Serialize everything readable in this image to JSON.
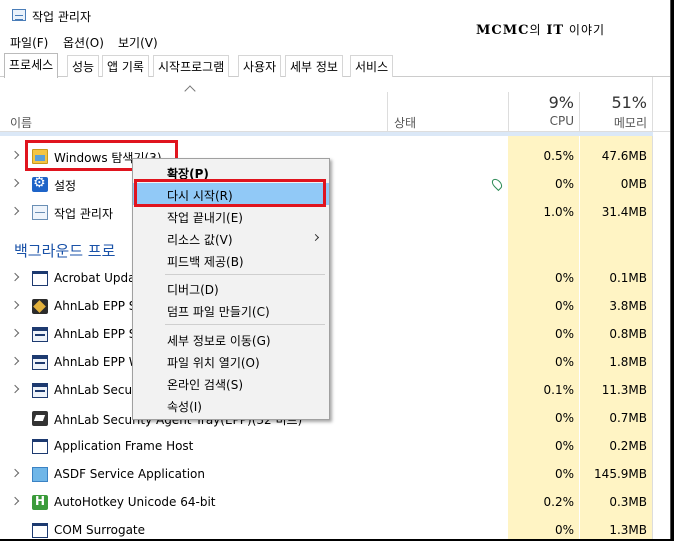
{
  "window": {
    "title": "작업 관리자"
  },
  "watermark": {
    "left": "MCMC",
    "mid": "의 ",
    "brand": "IT",
    "right": " 이야기"
  },
  "menu": {
    "file": "파일(F)",
    "options": "옵션(O)",
    "view": "보기(V)"
  },
  "tabs": [
    "프로세스",
    "성능",
    "앱 기록",
    "시작프로그램",
    "사용자",
    "세부 정보",
    "서비스"
  ],
  "columns": {
    "name": "이름",
    "status": "상태",
    "cpu_pct": "9%",
    "cpu_label": "CPU",
    "mem_pct": "51%",
    "mem_label": "메모리"
  },
  "rows": [
    {
      "name": "Windows 탐색기(3)",
      "cpu": "0.5%",
      "mem": "47.6MB",
      "icon": "folder-icon"
    },
    {
      "name": "설정",
      "cpu": "0%",
      "mem": "0MB",
      "icon": "gear-icon",
      "status_icon": "leaf-icon"
    },
    {
      "name": "작업 관리자",
      "cpu": "1.0%",
      "mem": "31.4MB",
      "icon": "task-manager-icon"
    },
    {
      "name": "Acrobat Updat",
      "cpu": "0%",
      "mem": "0.1MB",
      "icon": "window-icon"
    },
    {
      "name": "AhnLab EPP Se",
      "cpu": "0%",
      "mem": "3.8MB",
      "icon": "ahnlab-icon"
    },
    {
      "name": "AhnLab EPP Se",
      "cpu": "0%",
      "mem": "0.8MB",
      "icon": "ahnlab-window-icon"
    },
    {
      "name": "AhnLab EPP W",
      "cpu": "0%",
      "mem": "1.8MB",
      "icon": "ahnlab-window-icon"
    },
    {
      "name": "AhnLab Securi",
      "cpu": "0.1%",
      "mem": "11.3MB",
      "icon": "ahnlab-window-icon"
    },
    {
      "name": "AhnLab Security Agent Tray(EPP)(32 비트)",
      "cpu": "0%",
      "mem": "0.7MB",
      "icon": "ahnlab-security-icon"
    },
    {
      "name": "Application Frame Host",
      "cpu": "0%",
      "mem": "0.2MB",
      "icon": "window-icon"
    },
    {
      "name": "ASDF Service Application",
      "cpu": "0%",
      "mem": "145.9MB",
      "icon": "asdf-icon"
    },
    {
      "name": "AutoHotkey Unicode 64-bit",
      "cpu": "0.2%",
      "mem": "0.3MB",
      "icon": "autohotkey-icon"
    },
    {
      "name": "COM Surrogate",
      "cpu": "0%",
      "mem": "1.3MB",
      "icon": "window-icon"
    }
  ],
  "section": {
    "background": "백그라운드 프로"
  },
  "context_menu": {
    "items": [
      "확장(P)",
      "다시 시작(R)",
      "작업 끝내기(E)",
      "리소스 값(V)",
      "피드백 제공(B)",
      "디버그(D)",
      "덤프 파일 만들기(C)",
      "세부 정보로 이동(G)",
      "파일 위치 열기(O)",
      "온라인 검색(S)",
      "속성(I)"
    ]
  },
  "colors": {
    "highlight": "#91c9f7",
    "annotation_red": "#e0141e",
    "heat": "#fff4c4",
    "section_blue": "#1a52a8"
  }
}
